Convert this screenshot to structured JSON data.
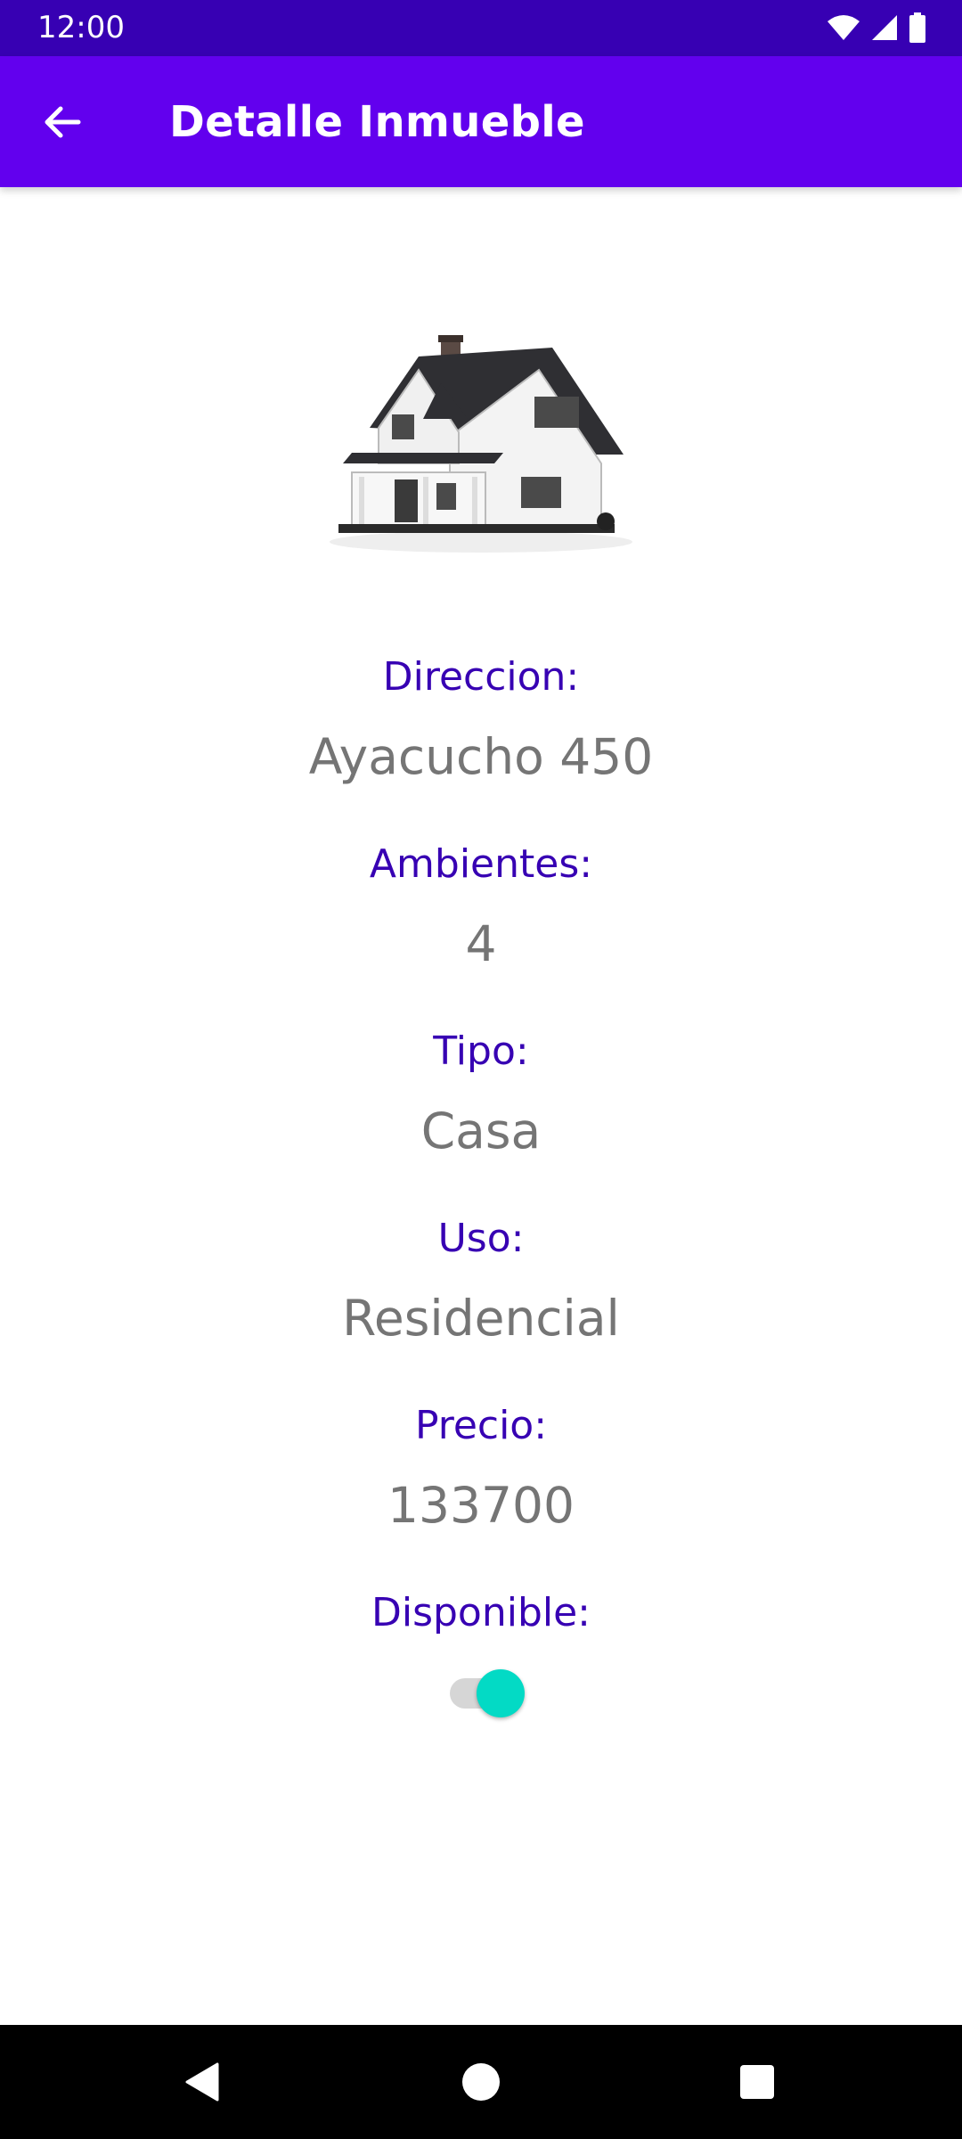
{
  "status_bar": {
    "time": "12:00",
    "icons": [
      "wifi-icon",
      "signal-icon",
      "battery-icon"
    ]
  },
  "app_bar": {
    "title": "Detalle Inmueble",
    "back_icon": "arrow-back-icon"
  },
  "property": {
    "image_icon": "house-image",
    "fields": [
      {
        "label": "Direccion:",
        "value": "Ayacucho 450"
      },
      {
        "label": "Ambientes:",
        "value": "4"
      },
      {
        "label": "Tipo:",
        "value": "Casa"
      },
      {
        "label": "Uso:",
        "value": "Residencial"
      },
      {
        "label": "Precio:",
        "value": "133700"
      }
    ],
    "available": {
      "label": "Disponible:",
      "checked": true
    }
  },
  "nav_bar": {
    "icons": [
      "back-triangle-icon",
      "home-circle-icon",
      "recents-square-icon"
    ]
  },
  "colors": {
    "status_bar": "#3700b3",
    "app_bar": "#6200ee",
    "label": "#3700b3",
    "value": "#757575",
    "switch_thumb": "#03dac5"
  }
}
